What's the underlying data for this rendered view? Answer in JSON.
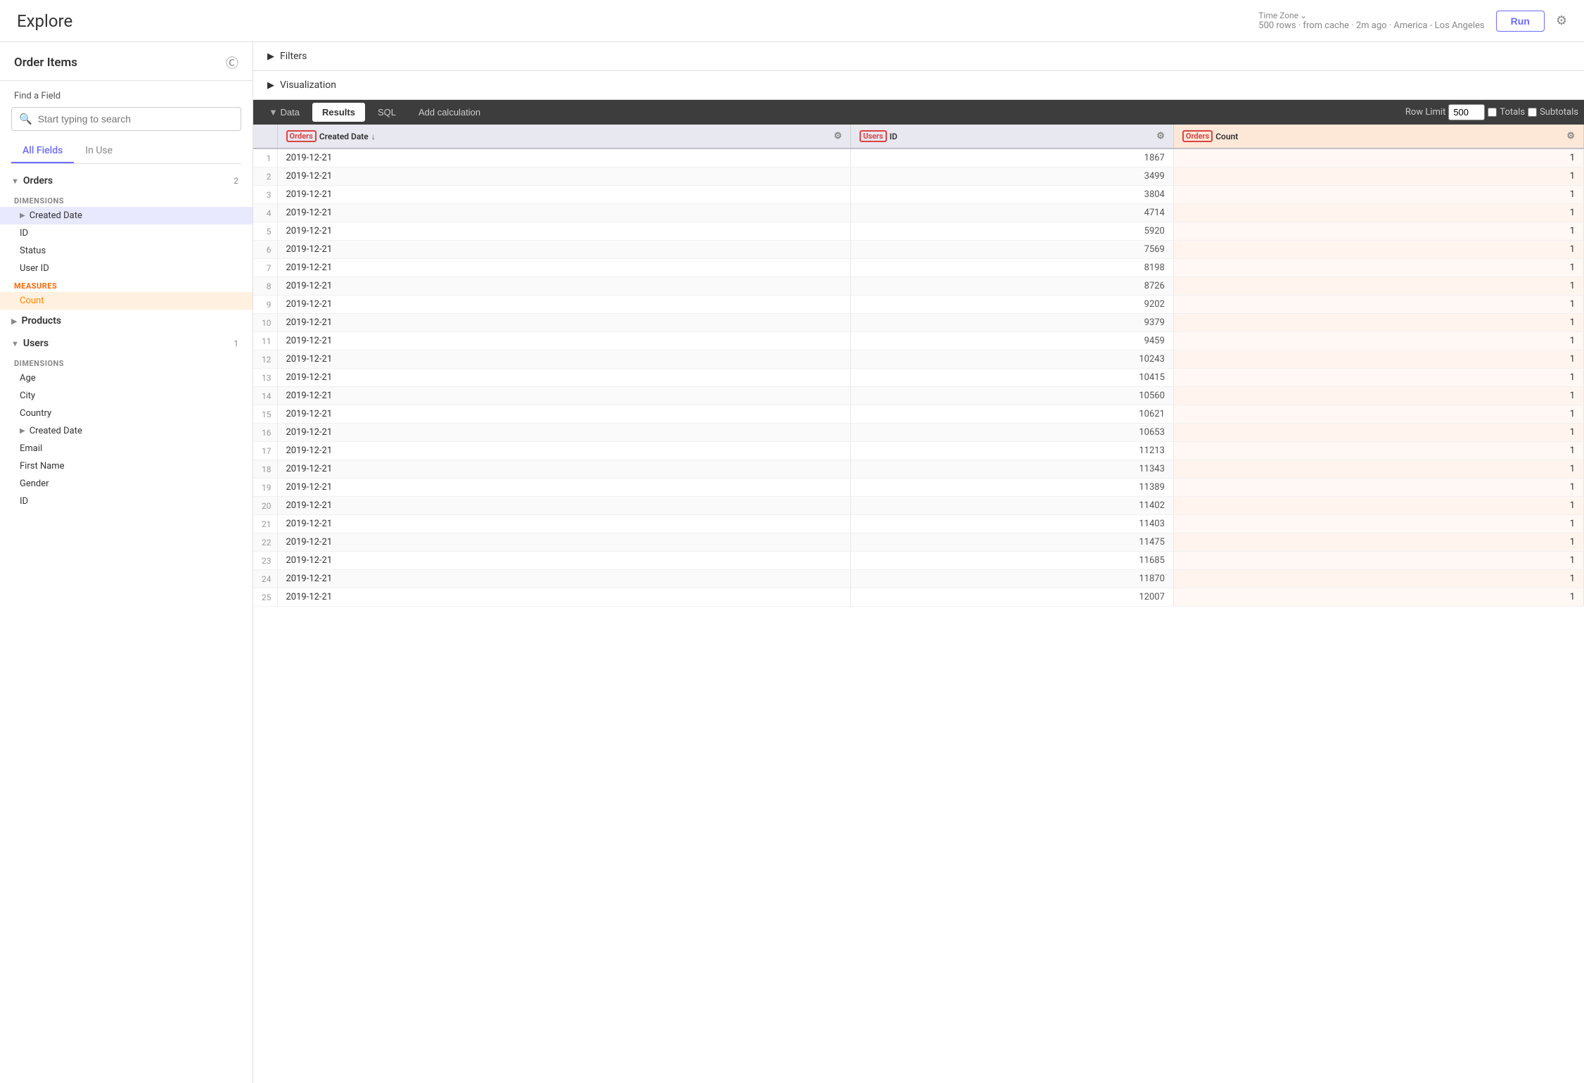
{
  "app": {
    "title": "Explore",
    "meta": "500 rows · from cache · 2m ago · America - Los Angeles",
    "timezone": "Time Zone",
    "run_label": "Run"
  },
  "sidebar": {
    "title": "Order Items",
    "find_field_label": "Find a Field",
    "search_placeholder": "Start typing to search",
    "tabs": [
      "All Fields",
      "In Use"
    ],
    "groups": [
      {
        "name": "Orders",
        "count": 2,
        "expanded": true,
        "sections": [
          {
            "type": "DIMENSIONS",
            "fields": [
              {
                "name": "Created Date",
                "expandable": true,
                "active": true
              },
              {
                "name": "ID",
                "expandable": false
              },
              {
                "name": "Status",
                "expandable": false
              },
              {
                "name": "User ID",
                "expandable": false
              }
            ]
          },
          {
            "type": "MEASURES",
            "fields": [
              {
                "name": "Count",
                "expandable": false,
                "measure": true,
                "active": true
              }
            ]
          }
        ]
      },
      {
        "name": "Products",
        "count": null,
        "expanded": false,
        "sections": []
      },
      {
        "name": "Users",
        "count": 1,
        "expanded": true,
        "sections": [
          {
            "type": "DIMENSIONS",
            "fields": [
              {
                "name": "Age",
                "expandable": false
              },
              {
                "name": "City",
                "expandable": false
              },
              {
                "name": "Country",
                "expandable": false
              },
              {
                "name": "Created Date",
                "expandable": true
              },
              {
                "name": "Email",
                "expandable": false
              },
              {
                "name": "First Name",
                "expandable": false
              },
              {
                "name": "Gender",
                "expandable": false
              },
              {
                "name": "ID",
                "expandable": false
              }
            ]
          }
        ]
      }
    ]
  },
  "toolbar": {
    "data_label": "Data",
    "results_label": "Results",
    "sql_label": "SQL",
    "add_calc_label": "Add calculation",
    "row_limit_label": "Row Limit",
    "row_limit_value": "500",
    "totals_label": "Totals",
    "subtotals_label": "Subtotals"
  },
  "filters": {
    "label": "Filters"
  },
  "visualization": {
    "label": "Visualization"
  },
  "table": {
    "columns": [
      {
        "label": "Orders",
        "sub": "Created Date",
        "badge": "Orders",
        "sort": "↓",
        "measure": false
      },
      {
        "label": "Users",
        "sub": "ID",
        "badge": "Users",
        "sort": "",
        "measure": false
      },
      {
        "label": "Orders",
        "sub": "Count",
        "badge": "Orders",
        "sort": "",
        "measure": true
      }
    ],
    "rows": [
      [
        1,
        "2019-12-21",
        1867,
        1
      ],
      [
        2,
        "2019-12-21",
        3499,
        1
      ],
      [
        3,
        "2019-12-21",
        3804,
        1
      ],
      [
        4,
        "2019-12-21",
        4714,
        1
      ],
      [
        5,
        "2019-12-21",
        5920,
        1
      ],
      [
        6,
        "2019-12-21",
        7569,
        1
      ],
      [
        7,
        "2019-12-21",
        8198,
        1
      ],
      [
        8,
        "2019-12-21",
        8726,
        1
      ],
      [
        9,
        "2019-12-21",
        9202,
        1
      ],
      [
        10,
        "2019-12-21",
        9379,
        1
      ],
      [
        11,
        "2019-12-21",
        9459,
        1
      ],
      [
        12,
        "2019-12-21",
        10243,
        1
      ],
      [
        13,
        "2019-12-21",
        10415,
        1
      ],
      [
        14,
        "2019-12-21",
        10560,
        1
      ],
      [
        15,
        "2019-12-21",
        10621,
        1
      ],
      [
        16,
        "2019-12-21",
        10653,
        1
      ],
      [
        17,
        "2019-12-21",
        11213,
        1
      ],
      [
        18,
        "2019-12-21",
        11343,
        1
      ],
      [
        19,
        "2019-12-21",
        11389,
        1
      ],
      [
        20,
        "2019-12-21",
        11402,
        1
      ],
      [
        21,
        "2019-12-21",
        11403,
        1
      ],
      [
        22,
        "2019-12-21",
        11475,
        1
      ],
      [
        23,
        "2019-12-21",
        11685,
        1
      ],
      [
        24,
        "2019-12-21",
        11870,
        1
      ],
      [
        25,
        "2019-12-21",
        12007,
        1
      ]
    ]
  }
}
